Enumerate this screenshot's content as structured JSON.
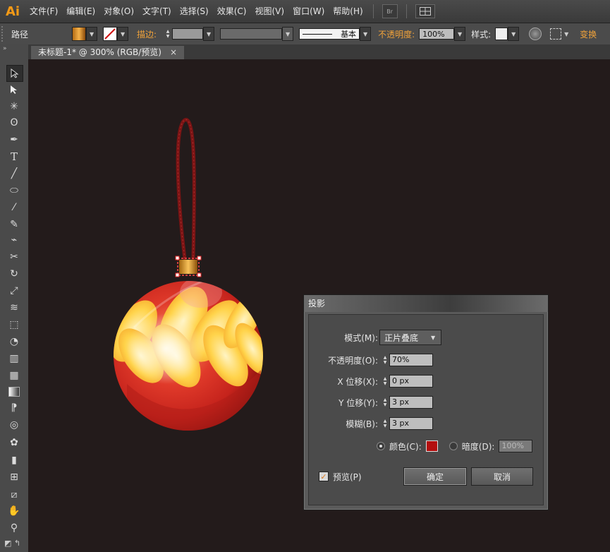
{
  "app": {
    "logo": "Ai"
  },
  "menu": {
    "items": [
      "文件(F)",
      "编辑(E)",
      "对象(O)",
      "文字(T)",
      "选择(S)",
      "效果(C)",
      "视图(V)",
      "窗口(W)",
      "帮助(H)"
    ],
    "bridge_label": "Br"
  },
  "control_bar": {
    "object_type": "路径",
    "stroke_label": "描边:",
    "stroke_style": "基本",
    "opacity_label": "不透明度:",
    "opacity_value": "100%",
    "style_label": "样式:",
    "transform_label": "变换"
  },
  "document_tab": {
    "title": "未标题-1* @ 300% (RGB/预览)",
    "close_glyph": "×"
  },
  "dialog": {
    "title": "投影",
    "mode_label": "模式(M):",
    "mode_value": "正片叠底",
    "opacity_label": "不透明度(O):",
    "opacity_value": "70%",
    "x_offset_label": "X 位移(X):",
    "x_offset_value": "0 px",
    "y_offset_label": "Y 位移(Y):",
    "y_offset_value": "3 px",
    "blur_label": "模糊(B):",
    "blur_value": "3 px",
    "color_label": "颜色(C):",
    "color_swatch": "#b30f0f",
    "darkness_label": "暗度(D):",
    "darkness_value": "100%",
    "preview_label": "预览(P)",
    "preview_checked": true,
    "ok_label": "确定",
    "cancel_label": "取消"
  },
  "colors": {
    "accent_orange": "#f59a16",
    "ornament_red": "#d62a22",
    "ornament_yellow": "#ffd34a",
    "cord": "#7a1414"
  }
}
